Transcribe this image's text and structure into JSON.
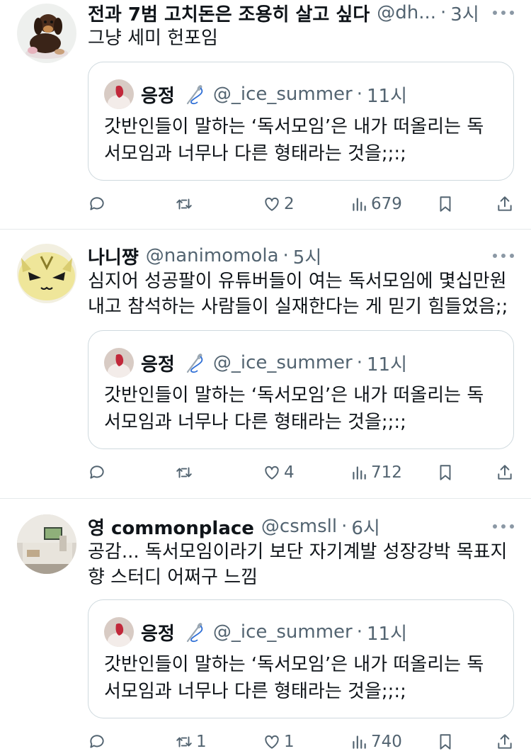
{
  "quoted_tweet": {
    "name": "응정",
    "handle": "@_ice_summer",
    "time": "11시",
    "text": "갓반인들이 말하는 ‘독서모임’은 내가 떠올리는 독서모임과 너무나 다른 형태라는 것을;;:;",
    "badge_icon": "needle-thread-icon"
  },
  "tweets": [
    {
      "name": "전과 7범 고치돈은 조용히 살고 싶다",
      "handle": "@dh...",
      "time": "3시",
      "text": "그냥 세미 헌포임",
      "replies": "",
      "retweets": "",
      "likes": "2",
      "views": "679",
      "avatar_icon": "puppy-toy-avatar"
    },
    {
      "name": "나니쨩",
      "handle": "@nanimomola",
      "time": "5시",
      "text": "심지어 성공팔이 유튜버들이 여는 독서모임에 몇십만원 내고 참석하는 사람들이 실재한다는 게 믿기 힘들었음;;",
      "replies": "",
      "retweets": "",
      "likes": "4",
      "views": "712",
      "avatar_icon": "cat-villager-avatar"
    },
    {
      "name": "영 commonplace",
      "handle": "@csmsll",
      "time": "6시",
      "text": "공감... 독서모임이라기 보단 자기계발 성장강박 목표지향 스터디 어쩌구 느낌",
      "replies": "",
      "retweets": "1",
      "likes": "1",
      "views": "740",
      "avatar_icon": "desk-photo-avatar"
    }
  ],
  "colors": {
    "text": "#0f1419",
    "muted": "#536471",
    "border": "#cfd9de"
  }
}
